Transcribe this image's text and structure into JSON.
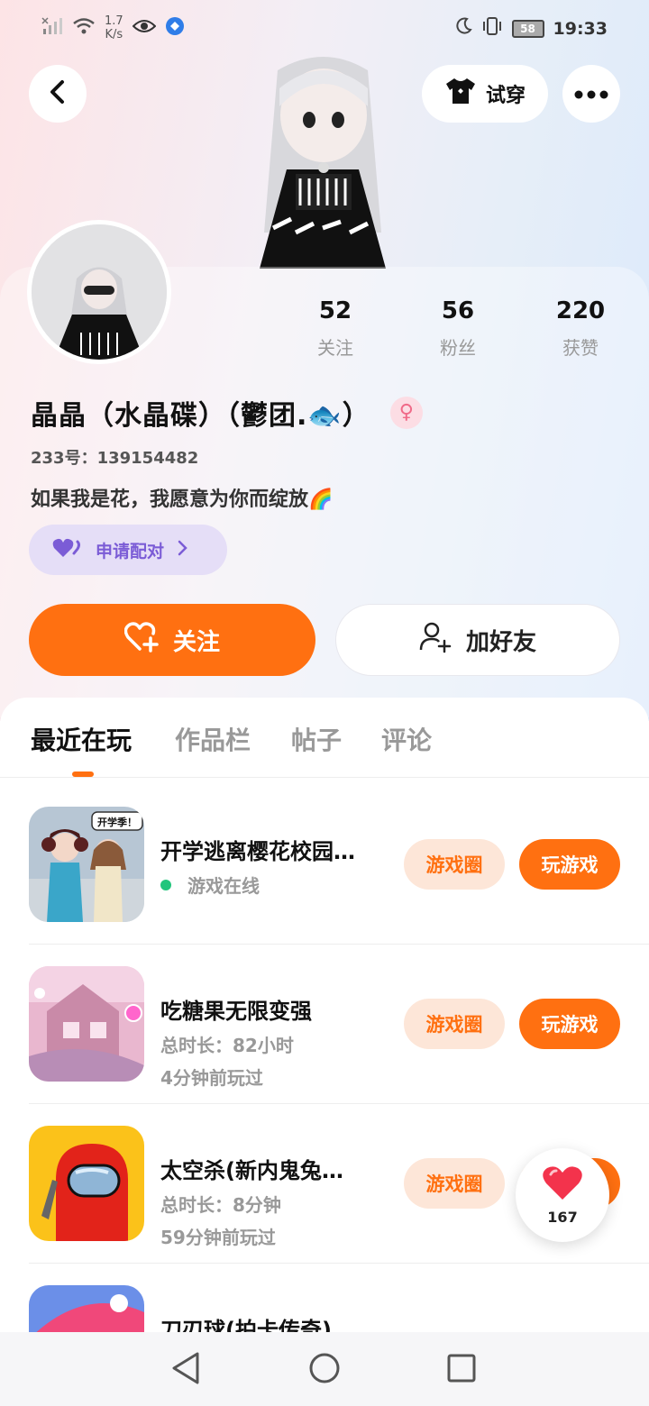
{
  "status_bar": {
    "net_speed_value": "1.7",
    "net_speed_unit": "K/s",
    "battery": "58",
    "time": "19:33"
  },
  "header": {
    "tryon_label": "试穿"
  },
  "profile": {
    "stats": [
      {
        "value": "52",
        "label": "关注"
      },
      {
        "value": "56",
        "label": "粉丝"
      },
      {
        "value": "220",
        "label": "获赞"
      }
    ],
    "username": "晶晶（水晶碟）（鬱团.🐟）",
    "gender_symbol": "♀",
    "id_line": "233号：139154482",
    "bio": "如果我是花，我愿意为你而绽放🌈",
    "pair_label": "申请配对"
  },
  "actions": {
    "follow_label": "关注",
    "add_friend_label": "加好友"
  },
  "tabs": [
    {
      "label": "最近在玩"
    },
    {
      "label": "作品栏"
    },
    {
      "label": "帖子"
    },
    {
      "label": "评论"
    }
  ],
  "games": [
    {
      "title": "开学逃离樱花校园…",
      "status": "游戏在线",
      "sub1": "",
      "sub2": "",
      "circle_label": "游戏圈",
      "play_label": "玩游戏"
    },
    {
      "title": "吃糖果无限变强",
      "status": "",
      "sub1": "总时长：82小时",
      "sub2": "4分钟前玩过",
      "circle_label": "游戏圈",
      "play_label": "玩游戏"
    },
    {
      "title": "太空杀(新内鬼兔…",
      "status": "",
      "sub1": "总时长：8分钟",
      "sub2": "59分钟前玩过",
      "circle_label": "游戏圈",
      "play_label": "玩游戏"
    },
    {
      "title": "刀刃球(拍卡传奇)",
      "status": "",
      "sub1": "",
      "sub2": "",
      "circle_label": "",
      "play_label": ""
    }
  ],
  "thumb_text": {
    "game1_bubble": "开学季！"
  },
  "like": {
    "count": "167"
  },
  "colors": {
    "accent": "#ff7011",
    "online": "#22c57c",
    "pair": "#7b5cd6"
  }
}
